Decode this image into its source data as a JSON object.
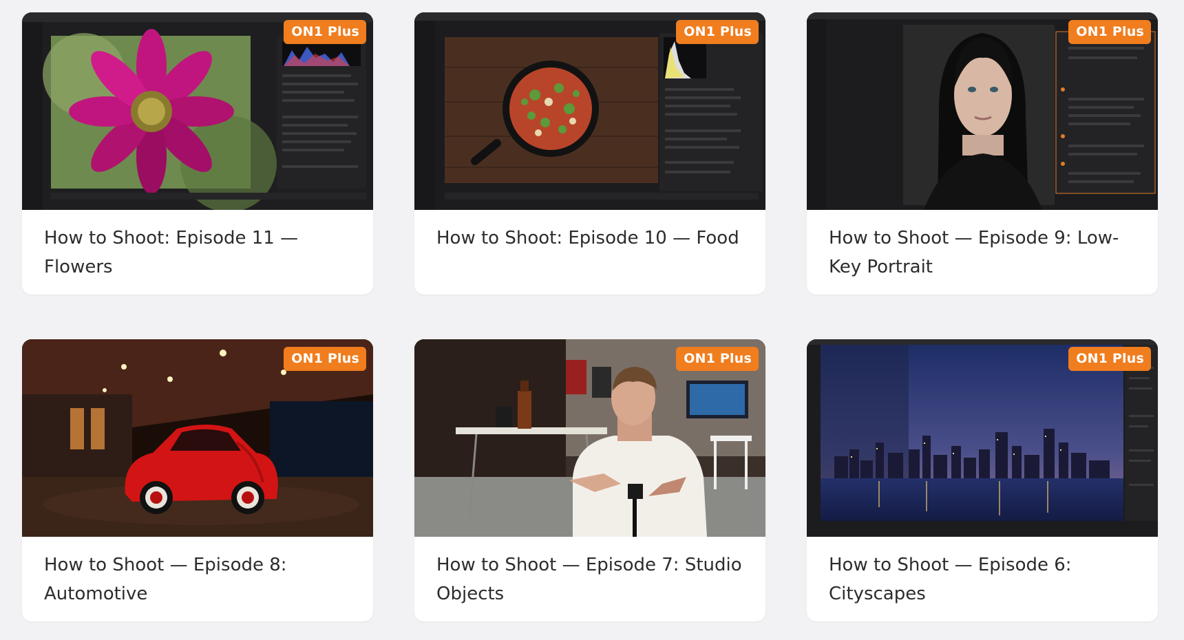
{
  "badge_label": "ON1 Plus",
  "colors": {
    "badge": "#f07d1e",
    "card_bg": "#ffffff",
    "page_bg": "#f2f2f4",
    "title_text": "#2c2c2e"
  },
  "cards": [
    {
      "title": "How to Shoot: Episode 11 — Flowers",
      "thumbnail": "flower-edit-thumbnail"
    },
    {
      "title": "How to Shoot: Episode 10 — Food",
      "thumbnail": "food-skillet-thumbnail"
    },
    {
      "title": "How to Shoot — Episode 9: Low-Key Portrait",
      "thumbnail": "portrait-thumbnail"
    },
    {
      "title": "How to Shoot — Episode 8: Automotive",
      "thumbnail": "red-car-thumbnail"
    },
    {
      "title": "How to Shoot — Episode 7: Studio Objects",
      "thumbnail": "studio-host-thumbnail"
    },
    {
      "title": "How to Shoot — Episode 6: Cityscapes",
      "thumbnail": "city-skyline-thumbnail"
    }
  ]
}
